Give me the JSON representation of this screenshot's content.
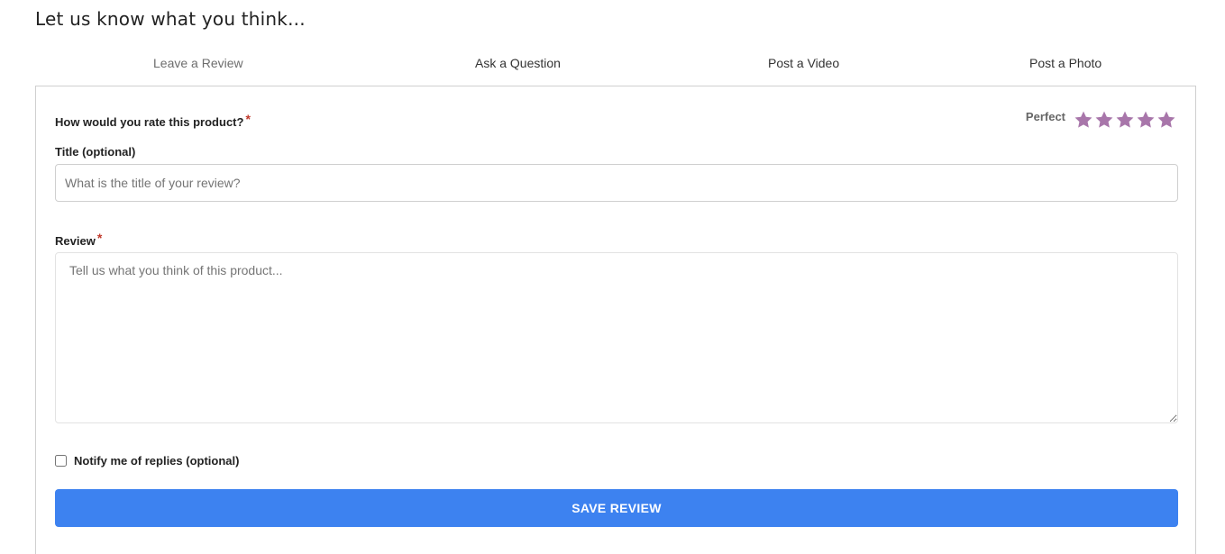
{
  "heading": "Let us know what you think...",
  "tabs": [
    {
      "label": "Leave a Review",
      "active": true
    },
    {
      "label": "Ask a Question",
      "active": false
    },
    {
      "label": "Post a Video",
      "active": false
    },
    {
      "label": "Post a Photo",
      "active": false
    }
  ],
  "form": {
    "rating": {
      "label": "How would you rate this product?",
      "required_mark": "*",
      "value_text": "Perfect",
      "stars_filled": 5,
      "stars_total": 5,
      "star_color": "#a876aa"
    },
    "title": {
      "label": "Title (optional)",
      "placeholder": "What is the title of your review?",
      "value": ""
    },
    "review": {
      "label": "Review",
      "required_mark": "*",
      "placeholder": "Tell us what you think of this product...",
      "value": ""
    },
    "notify": {
      "label": "Notify me of replies (optional)",
      "checked": false
    },
    "save_label": "SAVE REVIEW",
    "save_color": "#3d82f0"
  }
}
